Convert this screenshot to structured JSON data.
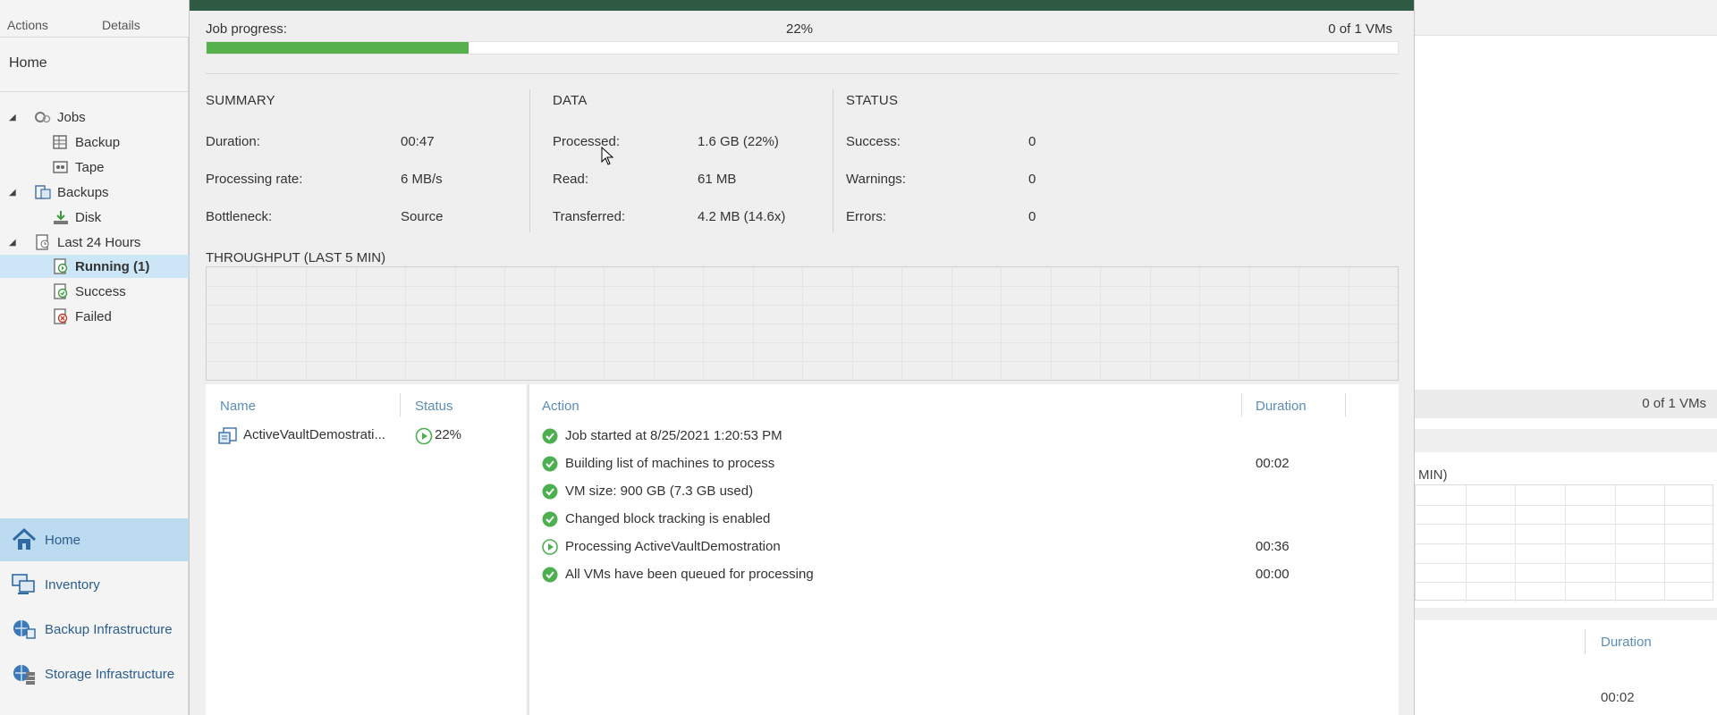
{
  "left_panel": {
    "tabs": [
      "Actions",
      "Details"
    ],
    "heading": "Home",
    "tree": [
      {
        "label": "Jobs",
        "icon": "jobs-icon"
      },
      {
        "label": "Backup",
        "icon": "backup-job-icon"
      },
      {
        "label": "Tape",
        "icon": "tape-job-icon"
      },
      {
        "label": "Backups",
        "icon": "backups-icon"
      },
      {
        "label": "Disk",
        "icon": "disk-icon"
      },
      {
        "label": "Last 24 Hours",
        "icon": "last-24-hours-icon"
      },
      {
        "label": "Running (1)",
        "icon": "running-icon",
        "selected": true
      },
      {
        "label": "Success",
        "icon": "success-icon"
      },
      {
        "label": "Failed",
        "icon": "failed-icon"
      }
    ],
    "nav": [
      {
        "label": "Home",
        "icon": "home-icon",
        "active": true
      },
      {
        "label": "Inventory",
        "icon": "inventory-icon"
      },
      {
        "label": "Backup Infrastructure",
        "icon": "backup-infrastructure-icon"
      },
      {
        "label": "Storage Infrastructure",
        "icon": "storage-infrastructure-icon"
      }
    ]
  },
  "job_dialog": {
    "progress": {
      "label": "Job progress:",
      "percent_text": "22%",
      "fraction": 0.22,
      "vms_text": "0 of 1 VMs"
    },
    "summary": {
      "heading": "SUMMARY",
      "rows": [
        {
          "label": "Duration:",
          "value": "00:47"
        },
        {
          "label": "Processing rate:",
          "value": "6 MB/s"
        },
        {
          "label": "Bottleneck:",
          "value": "Source"
        }
      ]
    },
    "data": {
      "heading": "DATA",
      "rows": [
        {
          "label": "Processed:",
          "value": "1.6 GB (22%)"
        },
        {
          "label": "Read:",
          "value": "61 MB"
        },
        {
          "label": "Transferred:",
          "value": "4.2 MB (14.6x)"
        }
      ]
    },
    "status": {
      "heading": "STATUS",
      "rows": [
        {
          "label": "Success:",
          "value": "0"
        },
        {
          "label": "Warnings:",
          "value": "0"
        },
        {
          "label": "Errors:",
          "value": "0"
        }
      ]
    },
    "throughput": {
      "heading": "THROUGHPUT (LAST 5 MIN)"
    },
    "vm_list": {
      "headers": {
        "name": "Name",
        "status": "Status"
      },
      "rows": [
        {
          "name": "ActiveVaultDemostrati...",
          "status": "22%",
          "status_icon": "running-play-icon"
        }
      ]
    },
    "log": {
      "headers": {
        "action": "Action",
        "duration": "Duration"
      },
      "rows": [
        {
          "icon": "success-check-icon",
          "action": "Job started at 8/25/2021 1:20:53 PM",
          "duration": ""
        },
        {
          "icon": "success-check-icon",
          "action": "Building list of machines to process",
          "duration": "00:02"
        },
        {
          "icon": "success-check-icon",
          "action": "VM size: 900 GB (7.3 GB used)",
          "duration": ""
        },
        {
          "icon": "success-check-icon",
          "action": "Changed block tracking is enabled",
          "duration": ""
        },
        {
          "icon": "running-play-icon",
          "action": "Processing ActiveVaultDemostration",
          "duration": "00:36"
        },
        {
          "icon": "success-check-icon",
          "action": "All VMs have been queued for processing",
          "duration": "00:00"
        }
      ]
    }
  },
  "right_background": {
    "vms_text": "0 of 1 VMs",
    "min_label": "MIN)",
    "duration_header": "Duration",
    "duration_value": "00:02"
  },
  "colors": {
    "accent_green": "#56b14c",
    "title_bar": "#2f5b45",
    "link_blue": "#5b8db9",
    "selection": "#cde6f7"
  }
}
